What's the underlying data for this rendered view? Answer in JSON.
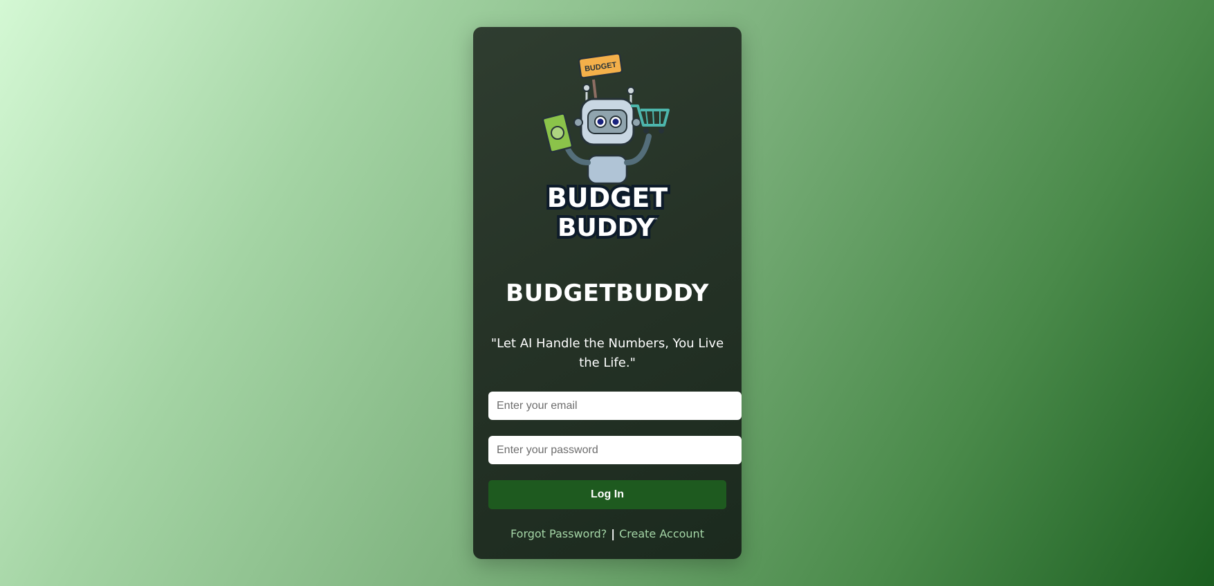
{
  "brand": {
    "title": "BUDGETBUDDY",
    "tagline": "\"Let AI Handle the Numbers, You Live the Life.\"",
    "logo": {
      "sign_text": "BUDGET",
      "line1": "BUDGET",
      "line2": "BUDDY",
      "trademark": "™"
    }
  },
  "form": {
    "email_placeholder": "Enter your email",
    "password_placeholder": "Enter your password",
    "login_label": "Log In"
  },
  "links": {
    "forgot_password": "Forgot Password?",
    "separator": "|",
    "create_account": "Create Account"
  },
  "colors": {
    "card_bg": "#253226",
    "button": "#1e5a1f",
    "link": "#a5d6a7"
  }
}
